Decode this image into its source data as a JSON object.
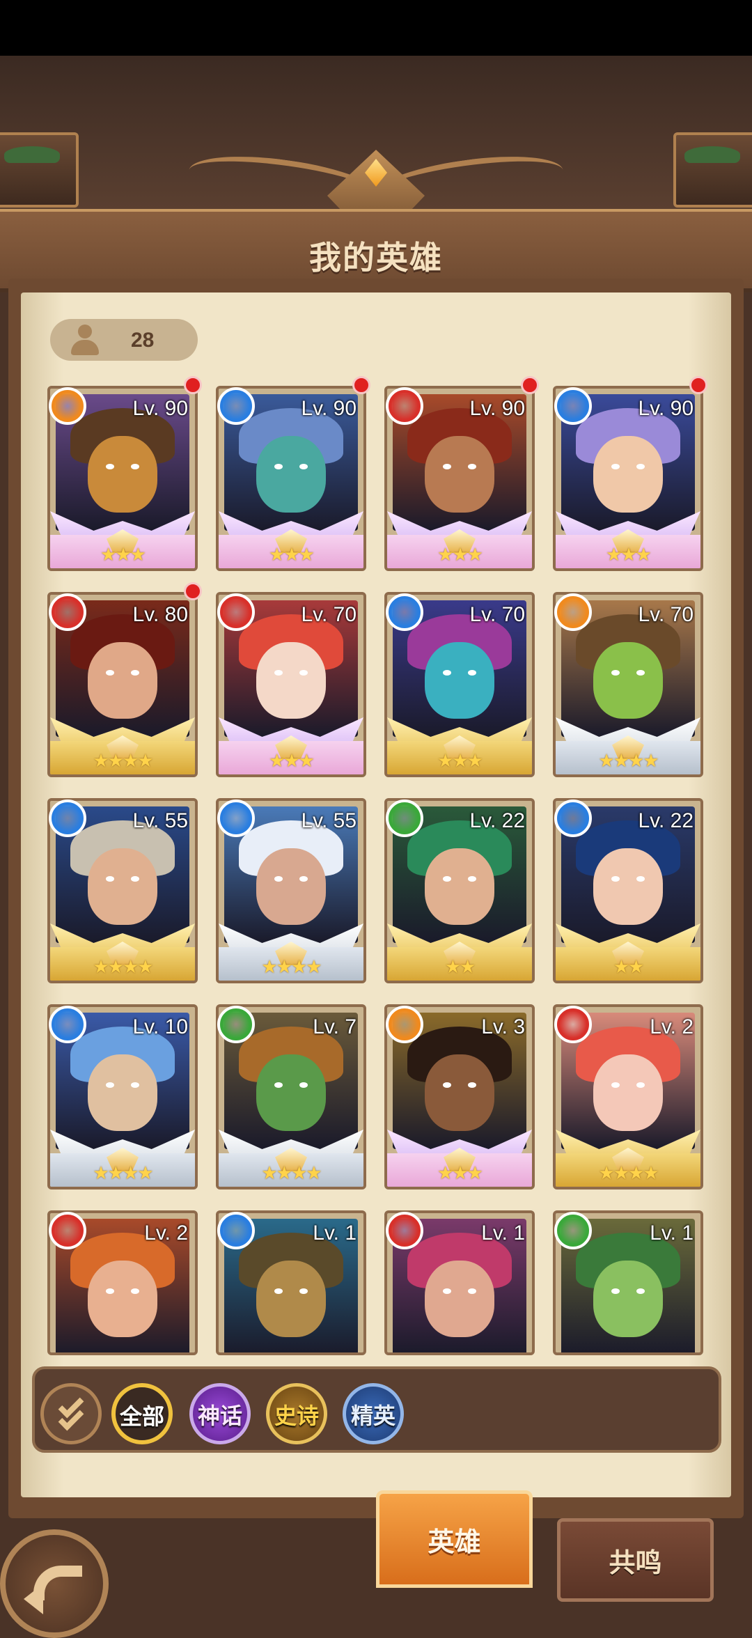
{
  "header": {
    "title": "我的英雄"
  },
  "hero_count": "28",
  "heroes": [
    {
      "level": "Lv. 90",
      "element": "#f08a1e",
      "stars": "★★★",
      "rarity": "mythic",
      "dot": true,
      "bg": "#6a4a8a",
      "skin": "#c98a3a",
      "hair": "#5a3a22"
    },
    {
      "level": "Lv. 90",
      "element": "#2a7ee0",
      "stars": "★★★",
      "rarity": "mythic",
      "dot": true,
      "bg": "#3a5a9a",
      "skin": "#4aa8a0",
      "hair": "#6a8ac8"
    },
    {
      "level": "Lv. 90",
      "element": "#d8302a",
      "stars": "★★★",
      "rarity": "mythic",
      "dot": true,
      "bg": "#a84a2a",
      "skin": "#b87a52",
      "hair": "#8a2a1a"
    },
    {
      "level": "Lv. 90",
      "element": "#2a7ee0",
      "stars": "★★★",
      "rarity": "mythic",
      "dot": true,
      "bg": "#3a4a9a",
      "skin": "#f0c8a8",
      "hair": "#9a8ad8"
    },
    {
      "level": "Lv. 80",
      "element": "#d8302a",
      "stars": "★★★★",
      "rarity": "epic",
      "dot": true,
      "bg": "#7a2a1a",
      "skin": "#e0a888",
      "hair": "#6a1a12"
    },
    {
      "level": "Lv. 70",
      "element": "#d8302a",
      "stars": "★★★",
      "rarity": "mythic",
      "dot": false,
      "bg": "#a83a3a",
      "skin": "#f4d8c8",
      "hair": "#e04a3a"
    },
    {
      "level": "Lv. 70",
      "element": "#2a7ee0",
      "stars": "★★★",
      "rarity": "epic",
      "dot": false,
      "bg": "#3a3a8a",
      "skin": "#3ab0c0",
      "hair": "#9a3a9a"
    },
    {
      "level": "Lv. 70",
      "element": "#f08a1e",
      "stars": "★★★★",
      "rarity": "elite",
      "dot": false,
      "bg": "#a8784a",
      "skin": "#8ac04a",
      "hair": "#6a4a2a"
    },
    {
      "level": "Lv. 55",
      "element": "#2a7ee0",
      "stars": "★★★★",
      "rarity": "epic",
      "dot": false,
      "bg": "#2a4a8a",
      "skin": "#e0b090",
      "hair": "#c8c0b0"
    },
    {
      "level": "Lv. 55",
      "element": "#2a7ee0",
      "stars": "★★★★",
      "rarity": "elite",
      "dot": false,
      "bg": "#4a7ab8",
      "skin": "#d8a890",
      "hair": "#e8eef8"
    },
    {
      "level": "Lv. 22",
      "element": "#3aa83a",
      "stars": "★★",
      "rarity": "epic",
      "dot": false,
      "bg": "#2a5a3a",
      "skin": "#e0b090",
      "hair": "#2a8a5a"
    },
    {
      "level": "Lv. 22",
      "element": "#2a7ee0",
      "stars": "★★",
      "rarity": "epic",
      "dot": false,
      "bg": "#2a3a6a",
      "skin": "#f0c8b0",
      "hair": "#1a3a7a"
    },
    {
      "level": "Lv. 10",
      "element": "#2a7ee0",
      "stars": "★★★★",
      "rarity": "elite",
      "dot": false,
      "bg": "#3a5aa8",
      "skin": "#e0c0a0",
      "hair": "#6aa0e0"
    },
    {
      "level": "Lv. 7",
      "element": "#3aa83a",
      "stars": "★★★★",
      "rarity": "elite",
      "dot": false,
      "bg": "#6a5a3a",
      "skin": "#5a9a4a",
      "hair": "#a86a2a"
    },
    {
      "level": "Lv. 3",
      "element": "#f08a1e",
      "stars": "★★★",
      "rarity": "mythic",
      "dot": false,
      "bg": "#8a6a2a",
      "skin": "#8a5a3a",
      "hair": "#2a1a12"
    },
    {
      "level": "Lv. 2",
      "element": "#d8302a",
      "stars": "★★★★",
      "rarity": "epic",
      "dot": false,
      "bg": "#d88a7a",
      "skin": "#f4c8b8",
      "hair": "#e85a4a"
    },
    {
      "level": "Lv. 2",
      "element": "#d8302a",
      "stars": "",
      "rarity": "epic",
      "dot": false,
      "bg": "#a84a2a",
      "skin": "#e8b090",
      "hair": "#d86a2a"
    },
    {
      "level": "Lv. 1",
      "element": "#2a7ee0",
      "stars": "",
      "rarity": "epic",
      "dot": false,
      "bg": "#2a6a8a",
      "skin": "#b08a4a",
      "hair": "#5a4a2a"
    },
    {
      "level": "Lv. 1",
      "element": "#d8302a",
      "stars": "",
      "rarity": "epic",
      "dot": false,
      "bg": "#7a3a6a",
      "skin": "#e0a890",
      "hair": "#c03a6a"
    },
    {
      "level": "Lv. 1",
      "element": "#3aa83a",
      "stars": "",
      "rarity": "epic",
      "dot": false,
      "bg": "#6a6a3a",
      "skin": "#8ac060",
      "hair": "#3a7a3a"
    }
  ],
  "filters": {
    "all": "全部",
    "mythic": "神话",
    "epic": "史诗",
    "elite": "精英"
  },
  "tabs": {
    "heroes": "英雄",
    "resonance": "共鸣"
  }
}
